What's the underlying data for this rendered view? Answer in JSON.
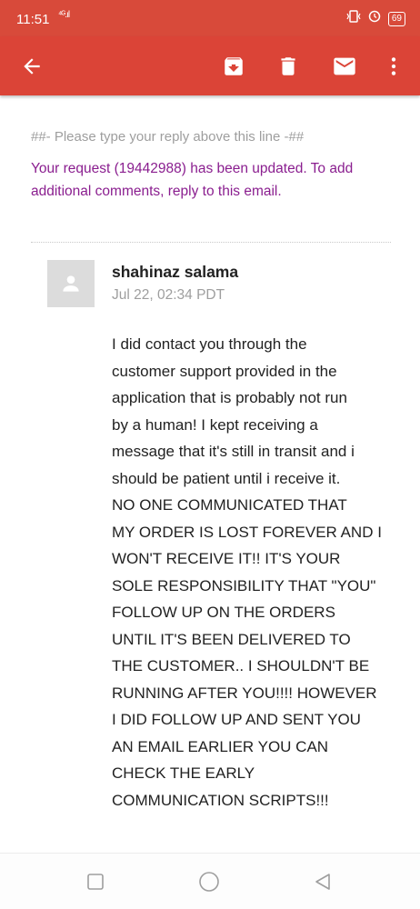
{
  "status_bar": {
    "time": "11:51",
    "signal": "⁴ᴳ.ıl",
    "battery": "69"
  },
  "app_bar": {
    "icons": [
      "back-arrow-icon",
      "archive-icon",
      "delete-icon",
      "mail-icon",
      "more-vert-icon"
    ],
    "color": "#db4437"
  },
  "email": {
    "reply_line": "##- Please type your reply above this line -##",
    "update_notice": "Your request (19442988) has been updated. To add additional comments, reply to this email.",
    "sender": "shahinaz salama",
    "date": "Jul 22, 02:34 PDT",
    "body_lines": [
      "I did contact you through the",
      "customer support provided in the",
      "application that is probably not run",
      "by a human! I kept receiving a",
      "message that it's still in transit and i",
      "should be patient until i receive it.",
      "NO ONE COMMUNICATED THAT",
      "MY ORDER IS LOST FOREVER AND I",
      "WON'T RECEIVE IT!! IT'S YOUR",
      "SOLE RESPONSIBILITY THAT \"YOU\"",
      "FOLLOW UP ON THE ORDERS",
      "UNTIL IT'S BEEN DELIVERED TO",
      "THE CUSTOMER.. I SHOULDN'T BE",
      "RUNNING AFTER YOU!!!! HOWEVER",
      "I DID FOLLOW UP AND SENT YOU",
      "AN EMAIL EARLIER YOU CAN",
      "CHECK THE EARLY",
      "COMMUNICATION SCRIPTS!!!"
    ]
  },
  "nav_bar": {
    "icons": [
      "recent-apps-icon",
      "home-icon",
      "back-icon"
    ]
  }
}
